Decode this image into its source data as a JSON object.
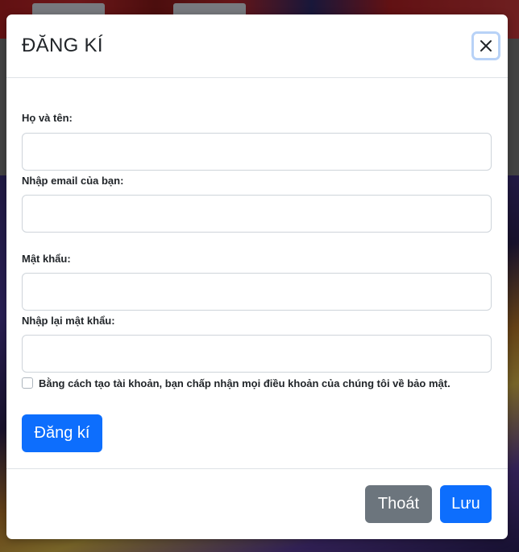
{
  "modal": {
    "title": "ĐĂNG KÍ",
    "close_icon": "close-icon"
  },
  "form": {
    "fullname_label": "Họ và tên:",
    "fullname_value": "",
    "email_label": "Nhập email của bạn:",
    "email_value": "",
    "password_label": "Mật khẩu:",
    "password_value": "",
    "confirm_password_label": "Nhập lại mật khẩu:",
    "confirm_password_value": "",
    "terms_text": "Bằng cách tạo tài khoản, bạn chấp nhận mọi điều khoản của chúng tôi về bảo mật.",
    "terms_checked": false,
    "register_button": "Đăng kí"
  },
  "footer": {
    "exit_button": "Thoát",
    "save_button": "Lưu"
  },
  "colors": {
    "primary": "#0d6efd",
    "secondary": "#6c757d",
    "close_focus_ring": "#b8d2f7"
  }
}
